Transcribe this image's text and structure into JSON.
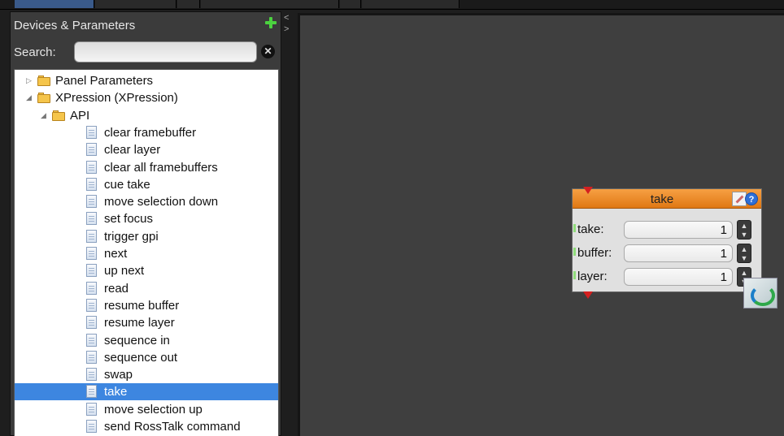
{
  "panel": {
    "title": "Devices & Parameters",
    "search_label": "Search:",
    "search_value": "",
    "search_placeholder": ""
  },
  "tree": [
    {
      "label": "Panel Parameters",
      "type": "folder",
      "level": 0,
      "expanded": false
    },
    {
      "label": "XPression (XPression)",
      "type": "folder",
      "level": 0,
      "expanded": true
    },
    {
      "label": "API",
      "type": "folder",
      "level": 1,
      "expanded": true
    },
    {
      "label": "clear framebuffer",
      "type": "file",
      "level": 2
    },
    {
      "label": "clear layer",
      "type": "file",
      "level": 2
    },
    {
      "label": "clear all framebuffers",
      "type": "file",
      "level": 2
    },
    {
      "label": "cue take",
      "type": "file",
      "level": 2
    },
    {
      "label": "move selection down",
      "type": "file",
      "level": 2
    },
    {
      "label": "set focus",
      "type": "file",
      "level": 2
    },
    {
      "label": "trigger gpi",
      "type": "file",
      "level": 2
    },
    {
      "label": "next",
      "type": "file",
      "level": 2
    },
    {
      "label": "up next",
      "type": "file",
      "level": 2
    },
    {
      "label": "read",
      "type": "file",
      "level": 2
    },
    {
      "label": "resume buffer",
      "type": "file",
      "level": 2
    },
    {
      "label": "resume layer",
      "type": "file",
      "level": 2
    },
    {
      "label": "sequence in",
      "type": "file",
      "level": 2
    },
    {
      "label": "sequence out",
      "type": "file",
      "level": 2
    },
    {
      "label": "swap",
      "type": "file",
      "level": 2
    },
    {
      "label": "take",
      "type": "file",
      "level": 2,
      "selected": true
    },
    {
      "label": "move selection up",
      "type": "file",
      "level": 2
    },
    {
      "label": "send RossTalk command",
      "type": "file",
      "level": 2
    }
  ],
  "node": {
    "title": "take",
    "params": [
      {
        "label": "take:",
        "value": "1"
      },
      {
        "label": "buffer:",
        "value": "1"
      },
      {
        "label": "layer:",
        "value": "1"
      }
    ]
  },
  "colors": {
    "node_header": "#e8861f",
    "selection": "#3d86e0",
    "canvas": "#3f3f3f",
    "add_icon": "#4bd23f"
  }
}
